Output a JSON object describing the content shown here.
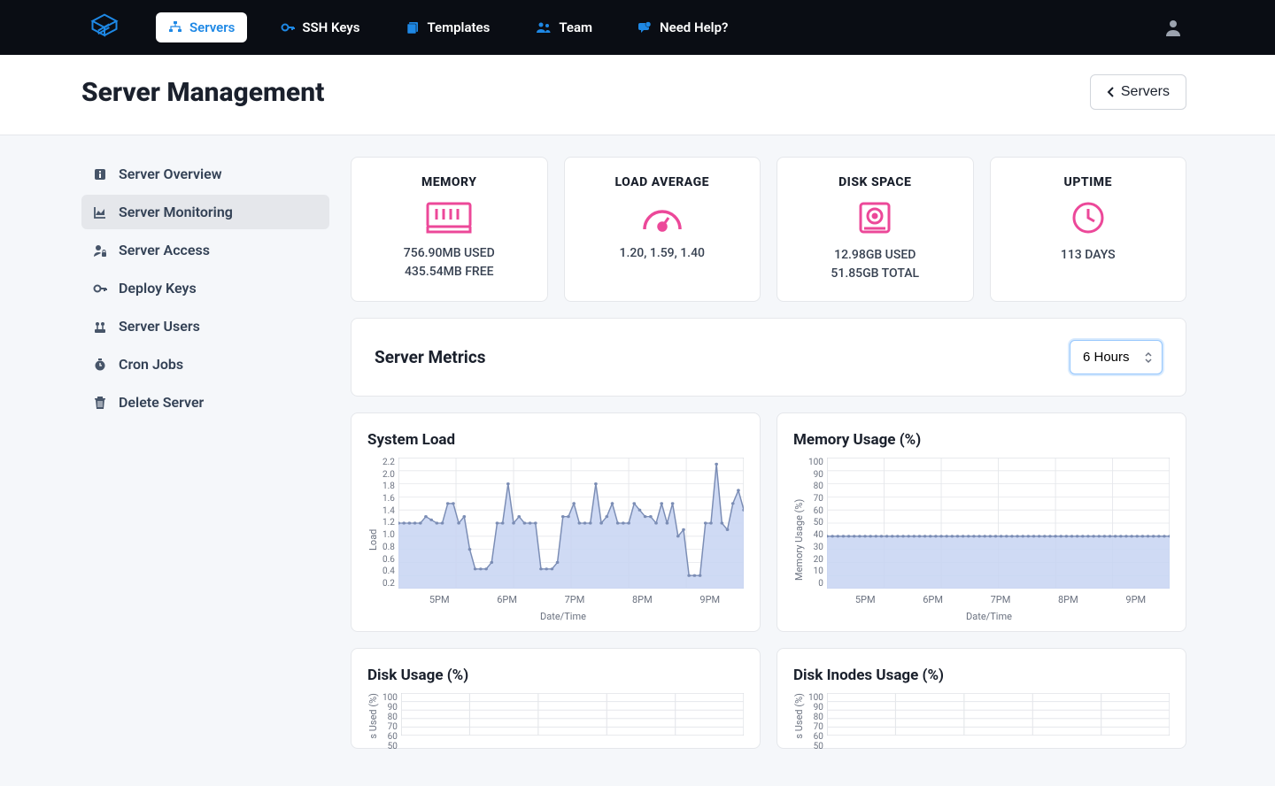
{
  "nav": {
    "items": [
      {
        "label": "Servers",
        "icon": "servers-icon"
      },
      {
        "label": "SSH Keys",
        "icon": "key-icon"
      },
      {
        "label": "Templates",
        "icon": "templates-icon"
      },
      {
        "label": "Team",
        "icon": "team-icon"
      },
      {
        "label": "Need Help?",
        "icon": "help-icon"
      }
    ]
  },
  "header": {
    "title": "Server Management",
    "back": "Servers"
  },
  "sidebar": {
    "items": [
      {
        "label": "Server Overview"
      },
      {
        "label": "Server Monitoring"
      },
      {
        "label": "Server Access"
      },
      {
        "label": "Deploy Keys"
      },
      {
        "label": "Server Users"
      },
      {
        "label": "Cron Jobs"
      },
      {
        "label": "Delete Server"
      }
    ]
  },
  "stats": {
    "memory": {
      "title": "MEMORY",
      "line1": "756.90MB USED",
      "line2": "435.54MB FREE"
    },
    "load": {
      "title": "LOAD AVERAGE",
      "line1": "1.20, 1.59, 1.40"
    },
    "disk": {
      "title": "DISK SPACE",
      "line1": "12.98GB USED",
      "line2": "51.85GB TOTAL"
    },
    "uptime": {
      "title": "UPTIME",
      "line1": "113 DAYS"
    }
  },
  "metrics": {
    "title": "Server Metrics",
    "range": "6 Hours"
  },
  "charts": {
    "systemLoad": {
      "title": "System Load",
      "ylabel": "Load",
      "xlabel": "Date/Time"
    },
    "memoryUsage": {
      "title": "Memory Usage (%)",
      "ylabel": "Memory Usage (%)",
      "xlabel": "Date/Time"
    },
    "diskUsage": {
      "title": "Disk Usage (%)",
      "ylabel": "s Used (%)"
    },
    "diskInodes": {
      "title": "Disk Inodes Usage (%)",
      "ylabel": "s Used (%)"
    }
  },
  "chart_data": [
    {
      "type": "area",
      "title": "System Load",
      "xlabel": "Date/Time",
      "ylabel": "Load",
      "ylim": [
        0.2,
        2.2
      ],
      "x_ticks": [
        "5PM",
        "6PM",
        "7PM",
        "8PM",
        "9PM"
      ],
      "y_ticks": [
        2.2,
        2.0,
        1.8,
        1.6,
        1.4,
        1.2,
        1.0,
        0.8,
        0.6,
        0.4,
        0.2
      ],
      "series": [
        {
          "name": "load",
          "values": [
            1.2,
            1.2,
            1.2,
            1.2,
            1.2,
            1.3,
            1.25,
            1.2,
            1.2,
            1.5,
            1.5,
            1.2,
            1.3,
            0.8,
            0.5,
            0.5,
            0.5,
            0.6,
            1.2,
            1.2,
            1.8,
            1.2,
            1.3,
            1.2,
            1.2,
            1.2,
            0.5,
            0.5,
            0.5,
            0.6,
            1.3,
            1.3,
            1.5,
            1.2,
            1.2,
            1.2,
            1.8,
            1.2,
            1.3,
            1.5,
            1.2,
            1.2,
            1.2,
            1.5,
            1.4,
            1.3,
            1.3,
            1.2,
            1.5,
            1.2,
            1.5,
            1.0,
            1.1,
            0.4,
            0.4,
            0.4,
            1.2,
            1.2,
            2.1,
            1.2,
            1.1,
            1.5,
            1.7,
            1.4
          ]
        }
      ]
    },
    {
      "type": "area",
      "title": "Memory Usage (%)",
      "xlabel": "Date/Time",
      "ylabel": "Memory Usage (%)",
      "ylim": [
        0,
        100
      ],
      "x_ticks": [
        "5PM",
        "6PM",
        "7PM",
        "8PM",
        "9PM"
      ],
      "y_ticks": [
        100,
        90,
        80,
        70,
        60,
        50,
        40,
        30,
        20,
        10,
        0
      ],
      "series": [
        {
          "name": "memory",
          "values": [
            40,
            40,
            40,
            40,
            40,
            40,
            40,
            40,
            40,
            40,
            40,
            40,
            40,
            40,
            40,
            40,
            40,
            40,
            40,
            40,
            40,
            40,
            40,
            40,
            40,
            40,
            40,
            40,
            40,
            40,
            40,
            40,
            40,
            40,
            40,
            40,
            40,
            40,
            40,
            40,
            40,
            40,
            40,
            40,
            40,
            40,
            40,
            40,
            40,
            40,
            40,
            40,
            40,
            40,
            40,
            40,
            40,
            40,
            40,
            40,
            40,
            40,
            40,
            40
          ]
        }
      ]
    },
    {
      "type": "area",
      "title": "Disk Usage (%)",
      "ylim": [
        0,
        100
      ],
      "y_ticks": [
        100,
        90,
        80,
        70,
        60,
        50
      ],
      "series": []
    },
    {
      "type": "area",
      "title": "Disk Inodes Usage (%)",
      "ylim": [
        0,
        100
      ],
      "y_ticks": [
        100,
        90,
        80,
        70,
        60,
        50
      ],
      "series": []
    }
  ]
}
